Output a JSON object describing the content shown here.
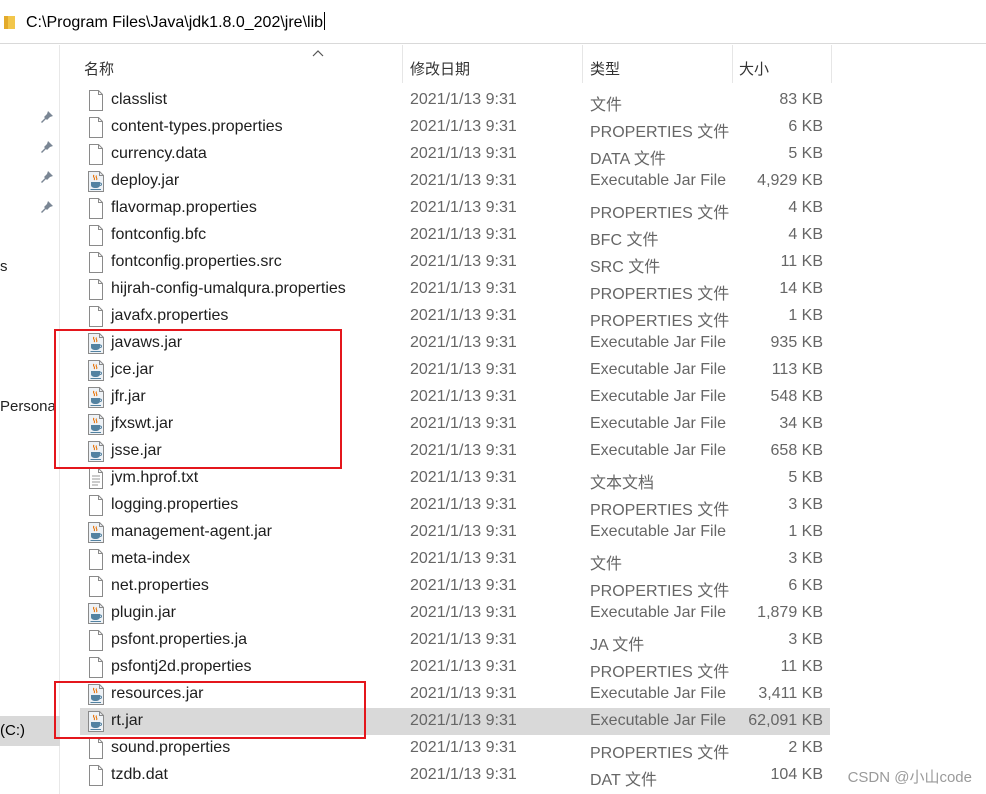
{
  "address": {
    "path": "C:\\Program Files\\Java\\jdk1.8.0_202\\jre\\lib"
  },
  "nav": {
    "partial_labels": [
      "s",
      "Persona"
    ],
    "drive_label": "(C:)"
  },
  "columns": {
    "name": "名称",
    "date": "修改日期",
    "type": "类型",
    "size": "大小"
  },
  "files": [
    {
      "name": "classlist",
      "date": "2021/1/13 9:31",
      "type": "文件",
      "size": "83 KB",
      "icon": "file-icon"
    },
    {
      "name": "content-types.properties",
      "date": "2021/1/13 9:31",
      "type": "PROPERTIES 文件",
      "size": "6 KB",
      "icon": "file-icon"
    },
    {
      "name": "currency.data",
      "date": "2021/1/13 9:31",
      "type": "DATA 文件",
      "size": "5 KB",
      "icon": "file-icon"
    },
    {
      "name": "deploy.jar",
      "date": "2021/1/13 9:31",
      "type": "Executable Jar File",
      "size": "4,929 KB",
      "icon": "java-jar-icon"
    },
    {
      "name": "flavormap.properties",
      "date": "2021/1/13 9:31",
      "type": "PROPERTIES 文件",
      "size": "4 KB",
      "icon": "file-icon"
    },
    {
      "name": "fontconfig.bfc",
      "date": "2021/1/13 9:31",
      "type": "BFC 文件",
      "size": "4 KB",
      "icon": "file-icon"
    },
    {
      "name": "fontconfig.properties.src",
      "date": "2021/1/13 9:31",
      "type": "SRC 文件",
      "size": "11 KB",
      "icon": "file-icon"
    },
    {
      "name": "hijrah-config-umalqura.properties",
      "date": "2021/1/13 9:31",
      "type": "PROPERTIES 文件",
      "size": "14 KB",
      "icon": "file-icon"
    },
    {
      "name": "javafx.properties",
      "date": "2021/1/13 9:31",
      "type": "PROPERTIES 文件",
      "size": "1 KB",
      "icon": "file-icon"
    },
    {
      "name": "javaws.jar",
      "date": "2021/1/13 9:31",
      "type": "Executable Jar File",
      "size": "935 KB",
      "icon": "java-jar-icon"
    },
    {
      "name": "jce.jar",
      "date": "2021/1/13 9:31",
      "type": "Executable Jar File",
      "size": "113 KB",
      "icon": "java-jar-icon"
    },
    {
      "name": "jfr.jar",
      "date": "2021/1/13 9:31",
      "type": "Executable Jar File",
      "size": "548 KB",
      "icon": "java-jar-icon"
    },
    {
      "name": "jfxswt.jar",
      "date": "2021/1/13 9:31",
      "type": "Executable Jar File",
      "size": "34 KB",
      "icon": "java-jar-icon"
    },
    {
      "name": "jsse.jar",
      "date": "2021/1/13 9:31",
      "type": "Executable Jar File",
      "size": "658 KB",
      "icon": "java-jar-icon"
    },
    {
      "name": "jvm.hprof.txt",
      "date": "2021/1/13 9:31",
      "type": "文本文档",
      "size": "5 KB",
      "icon": "text-file-icon"
    },
    {
      "name": "logging.properties",
      "date": "2021/1/13 9:31",
      "type": "PROPERTIES 文件",
      "size": "3 KB",
      "icon": "file-icon"
    },
    {
      "name": "management-agent.jar",
      "date": "2021/1/13 9:31",
      "type": "Executable Jar File",
      "size": "1 KB",
      "icon": "java-jar-icon"
    },
    {
      "name": "meta-index",
      "date": "2021/1/13 9:31",
      "type": "文件",
      "size": "3 KB",
      "icon": "file-icon"
    },
    {
      "name": "net.properties",
      "date": "2021/1/13 9:31",
      "type": "PROPERTIES 文件",
      "size": "6 KB",
      "icon": "file-icon"
    },
    {
      "name": "plugin.jar",
      "date": "2021/1/13 9:31",
      "type": "Executable Jar File",
      "size": "1,879 KB",
      "icon": "java-jar-icon"
    },
    {
      "name": "psfont.properties.ja",
      "date": "2021/1/13 9:31",
      "type": "JA 文件",
      "size": "3 KB",
      "icon": "file-icon"
    },
    {
      "name": "psfontj2d.properties",
      "date": "2021/1/13 9:31",
      "type": "PROPERTIES 文件",
      "size": "11 KB",
      "icon": "file-icon"
    },
    {
      "name": "resources.jar",
      "date": "2021/1/13 9:31",
      "type": "Executable Jar File",
      "size": "3,411 KB",
      "icon": "java-jar-icon"
    },
    {
      "name": "rt.jar",
      "date": "2021/1/13 9:31",
      "type": "Executable Jar File",
      "size": "62,091 KB",
      "icon": "java-jar-icon",
      "selected": true
    },
    {
      "name": "sound.properties",
      "date": "2021/1/13 9:31",
      "type": "PROPERTIES 文件",
      "size": "2 KB",
      "icon": "file-icon"
    },
    {
      "name": "tzdb.dat",
      "date": "2021/1/13 9:31",
      "type": "DAT 文件",
      "size": "104 KB",
      "icon": "file-icon"
    }
  ],
  "watermark": "CSDN @小山code",
  "colors": {
    "highlight_box": "#e4161c",
    "selection": "#d9d9d9"
  }
}
